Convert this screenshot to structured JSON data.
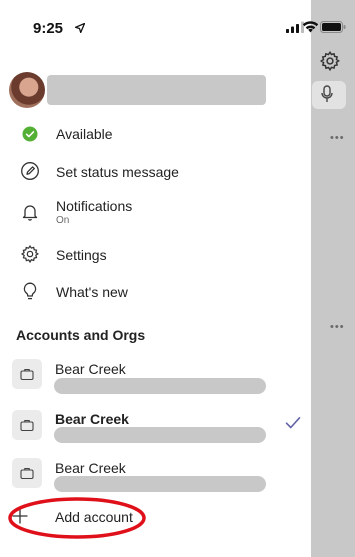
{
  "status_bar": {
    "time": "9:25"
  },
  "profile": {
    "avatar_icon": "avatar"
  },
  "menu": [
    {
      "id": "available",
      "label": "Available",
      "icon": "available-status-icon",
      "color": "#53b034"
    },
    {
      "id": "set-status",
      "label": "Set status message",
      "icon": "pencil-icon"
    },
    {
      "id": "notifications",
      "label": "Notifications",
      "sublabel": "On",
      "icon": "bell-icon"
    },
    {
      "id": "settings",
      "label": "Settings",
      "icon": "gear-icon"
    },
    {
      "id": "whats-new",
      "label": "What's new",
      "icon": "lightbulb-icon"
    }
  ],
  "accounts": {
    "title": "Accounts and Orgs",
    "items": [
      {
        "name": "Bear Creek",
        "active": false
      },
      {
        "name": "Bear Creek",
        "active": true
      },
      {
        "name": "Bear Creek",
        "active": false
      }
    ],
    "add_label": "Add account"
  },
  "colors": {
    "accent_check": "#6264a7",
    "annotation_circle": "#e0101a",
    "available_green": "#53b034"
  }
}
